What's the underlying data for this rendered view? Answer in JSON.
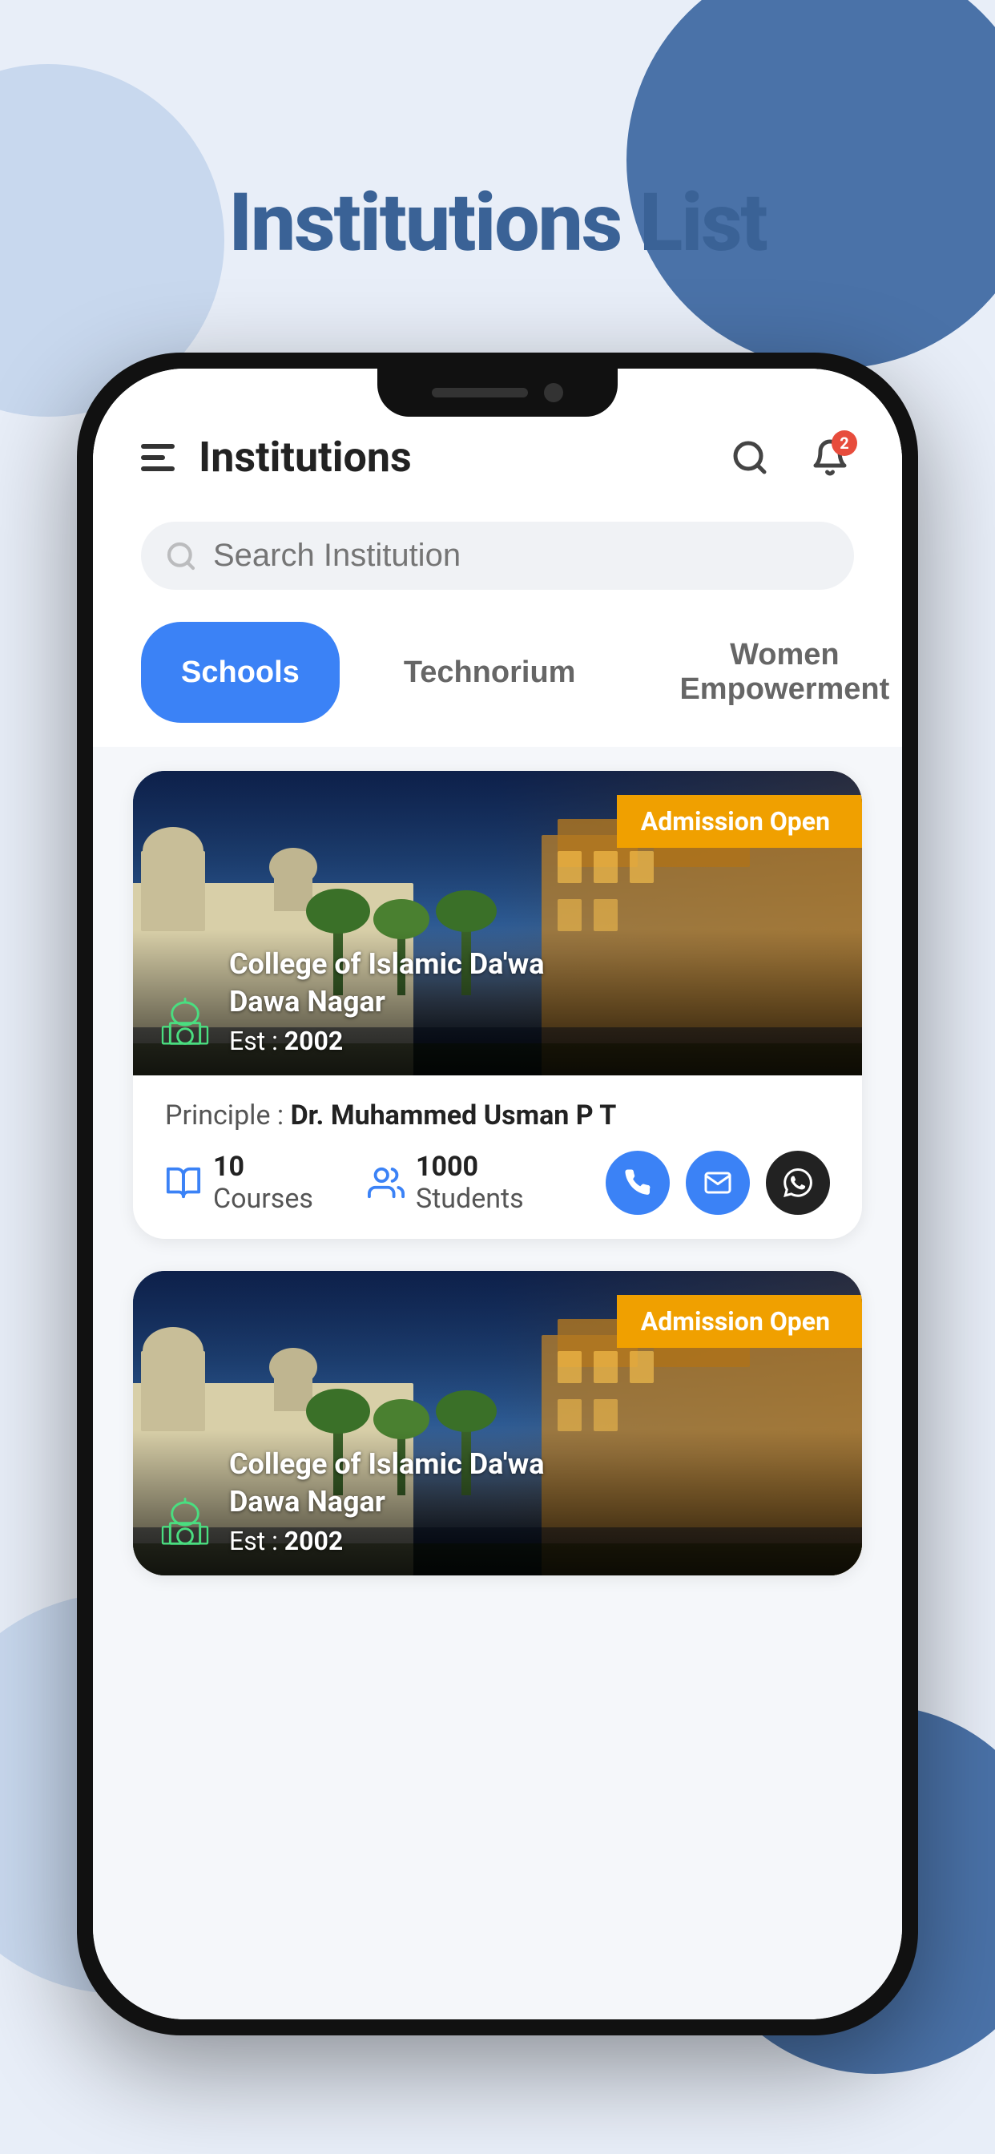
{
  "page": {
    "title": "Institutions List",
    "title_color": "#3a6296"
  },
  "header": {
    "title": "Institutions",
    "notification_badge": "2"
  },
  "search": {
    "placeholder": "Search Institution"
  },
  "tabs": [
    {
      "label": "Schools",
      "active": true
    },
    {
      "label": "Technorium",
      "active": false
    },
    {
      "label": "Women Empowerment",
      "active": false
    }
  ],
  "institutions": [
    {
      "name": "College of Islamic Da'wa\nDawa Nagar",
      "established": "2002",
      "admission_status": "Admission Open",
      "principle": "Dr. Muhammed Usman P T",
      "courses_count": "10",
      "students_count": "1000",
      "courses_label": "Courses",
      "students_label": "Students",
      "principle_prefix": "Principle :"
    },
    {
      "name": "College of Islamic Da'wa\nDawa Nagar",
      "established": "2002",
      "admission_status": "Admission Open",
      "principle": "",
      "courses_count": "",
      "students_count": "",
      "courses_label": "",
      "students_label": "",
      "principle_prefix": ""
    }
  ]
}
